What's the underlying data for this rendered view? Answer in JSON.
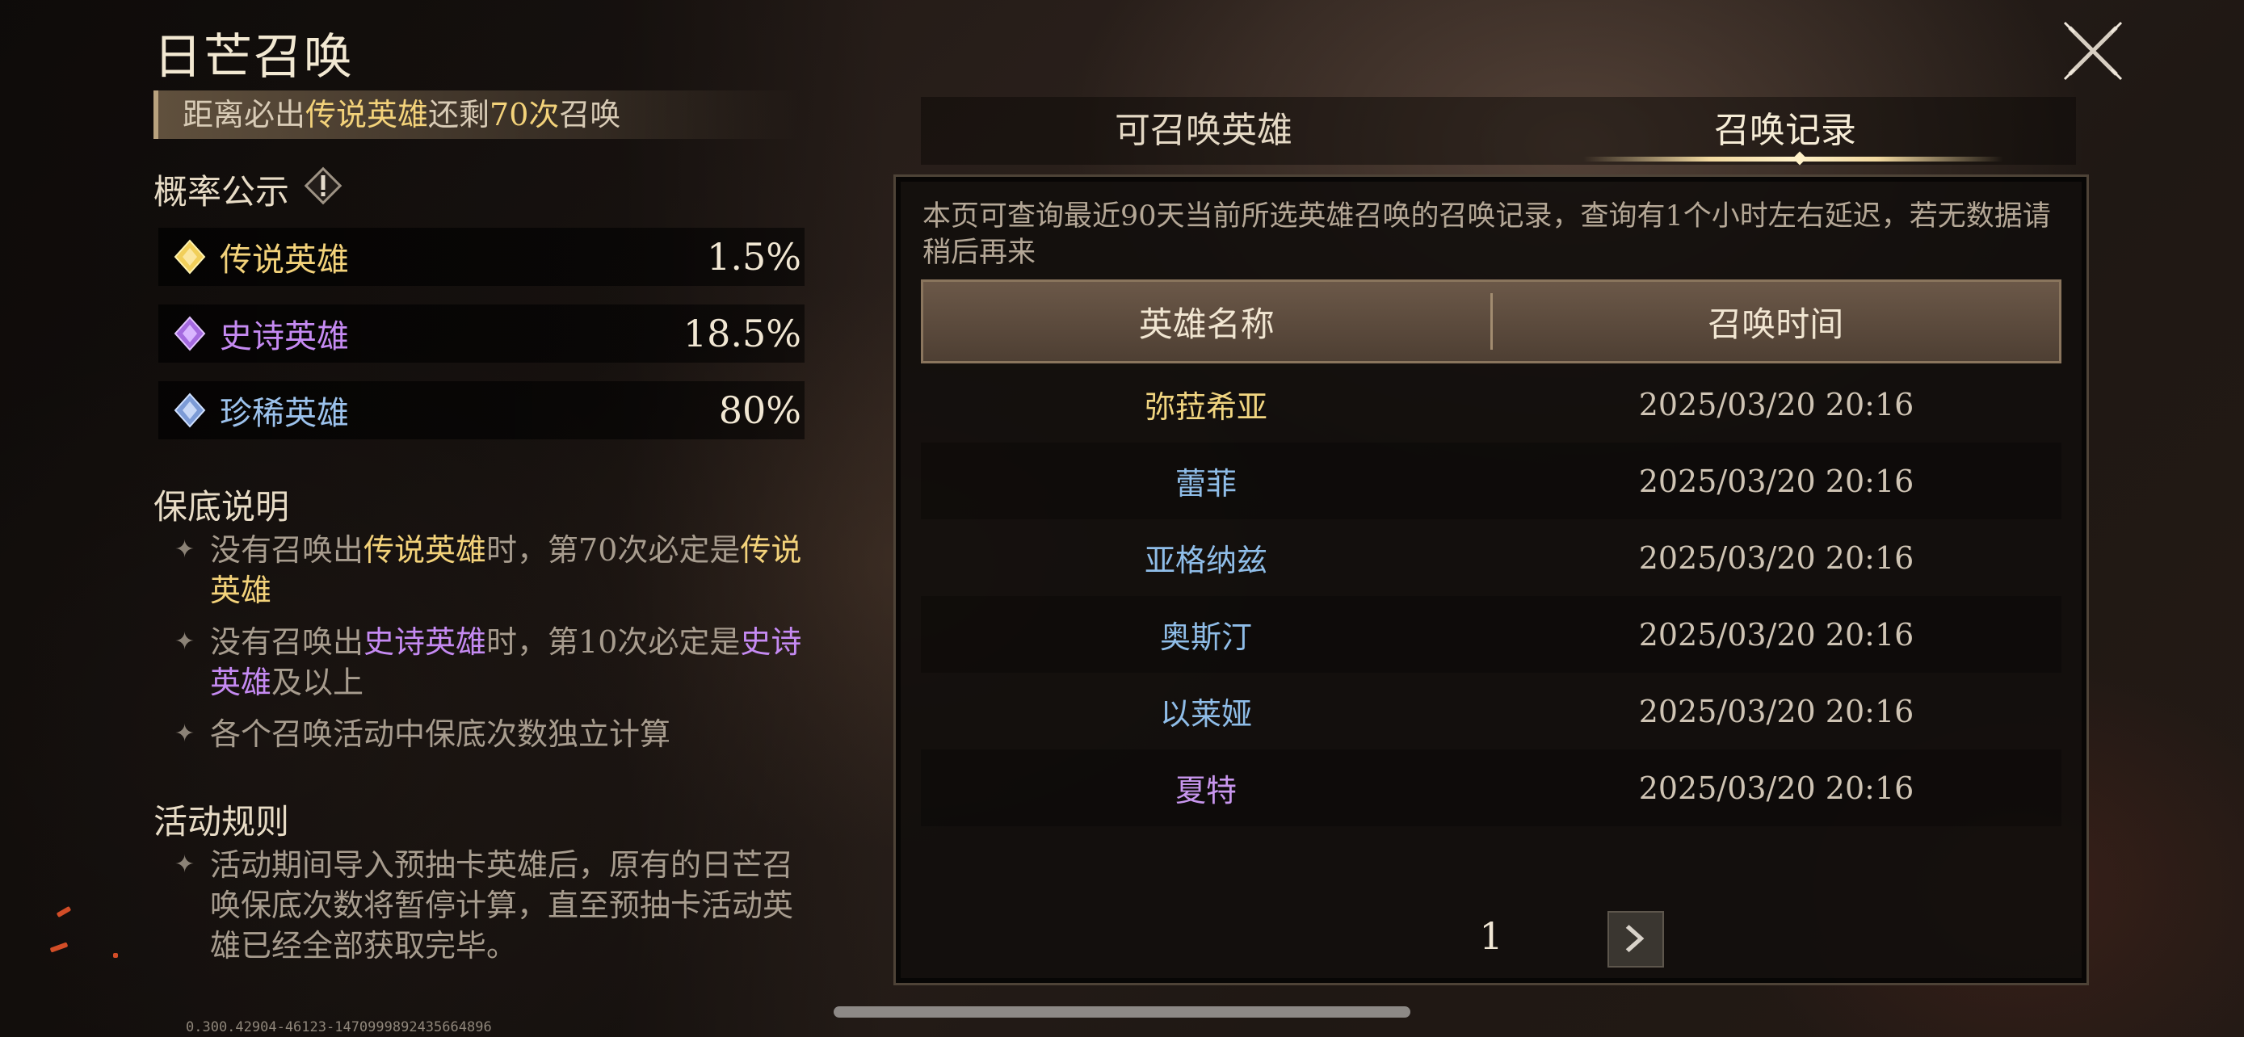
{
  "title": "日芒召唤",
  "pity_banner": {
    "prefix": "距离必出",
    "highlight": "传说英雄",
    "middle": "还剩",
    "count": "70次",
    "suffix": "召唤"
  },
  "probability": {
    "title": "概率公示",
    "rows": [
      {
        "name": "传说英雄",
        "percent": "1.5%",
        "color": "#f3d27a"
      },
      {
        "name": "史诗英雄",
        "percent": "18.5%",
        "color": "#c58af2"
      },
      {
        "name": "珍稀英雄",
        "percent": "80%",
        "color": "#9cc2ec"
      }
    ]
  },
  "pity_rules": {
    "title": "保底说明",
    "rule1": {
      "a": "没有召唤出",
      "b": "传说英雄",
      "c": "时，第70次必定是",
      "d": "传说英雄"
    },
    "rule2": {
      "a": "没有召唤出",
      "b": "史诗英雄",
      "c": "时，第10次必定是",
      "d": "史诗英雄",
      "e": "及以上"
    },
    "rule3": "各个召唤活动中保底次数独立计算"
  },
  "activity_rules": {
    "title": "活动规则",
    "rule1": "活动期间导入预抽卡英雄后，原有的日芒召唤保底次数将暂停计算，直至预抽卡活动英雄已经全部获取完毕。"
  },
  "version": "0.300.42904-46123-1470999892435664896",
  "tabs": {
    "heroes": "可召唤英雄",
    "records": "召唤记录"
  },
  "records": {
    "note": "本页可查询最近90天当前所选英雄召唤的召唤记录，查询有1个小时左右延迟，若无数据请稍后再来",
    "col_name": "英雄名称",
    "col_time": "召唤时间",
    "rows": [
      {
        "name": "弥菈希亚",
        "time": "2025/03/20 20:16",
        "rarity": "legendary"
      },
      {
        "name": "蕾菲",
        "time": "2025/03/20 20:16",
        "rarity": "rare"
      },
      {
        "name": "亚格纳兹",
        "time": "2025/03/20 20:16",
        "rarity": "rare"
      },
      {
        "name": "奥斯汀",
        "time": "2025/03/20 20:16",
        "rarity": "rare"
      },
      {
        "name": "以莱娅",
        "time": "2025/03/20 20:16",
        "rarity": "rare"
      },
      {
        "name": "夏特",
        "time": "2025/03/20 20:16",
        "rarity": "epic"
      }
    ],
    "page": "1"
  },
  "icons": {
    "close": "close-icon",
    "info": "info-icon",
    "next": "chevron-right-icon"
  }
}
